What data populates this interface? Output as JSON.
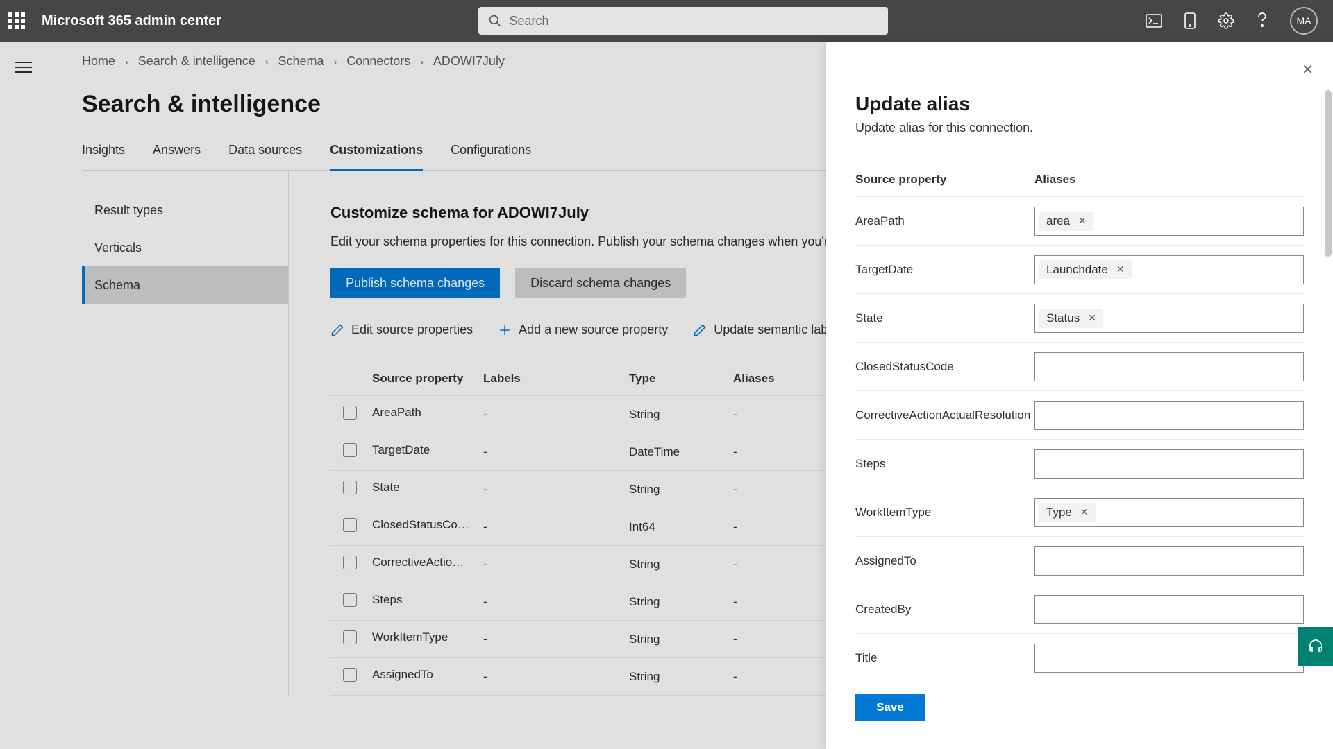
{
  "header": {
    "app_title": "Microsoft 365 admin center",
    "search_placeholder": "Search",
    "avatar_initials": "MA"
  },
  "breadcrumb": [
    "Home",
    "Search & intelligence",
    "Schema",
    "Connectors",
    "ADOWI7July"
  ],
  "page_title": "Search & intelligence",
  "tabs": [
    "Insights",
    "Answers",
    "Data sources",
    "Customizations",
    "Configurations"
  ],
  "active_tab": "Customizations",
  "sidenav": {
    "items": [
      "Result types",
      "Verticals",
      "Schema"
    ],
    "active": "Schema"
  },
  "section": {
    "title": "Customize schema for ADOWI7July",
    "desc": "Edit your schema properties for this connection. Publish your schema changes when you're done.",
    "publish_label": "Publish schema changes",
    "discard_label": "Discard schema changes"
  },
  "commands": {
    "edit": "Edit source properties",
    "add": "Add a new source property",
    "update": "Update semantic labels"
  },
  "table": {
    "headers": {
      "source": "Source property",
      "labels": "Labels",
      "type": "Type",
      "aliases": "Aliases"
    },
    "rows": [
      {
        "source": "AreaPath",
        "labels": "-",
        "type": "String",
        "aliases": "-"
      },
      {
        "source": "TargetDate",
        "labels": "-",
        "type": "DateTime",
        "aliases": "-"
      },
      {
        "source": "State",
        "labels": "-",
        "type": "String",
        "aliases": "-"
      },
      {
        "source": "ClosedStatusCode",
        "labels": "-",
        "type": "Int64",
        "aliases": "-"
      },
      {
        "source": "CorrectiveActio…",
        "labels": "-",
        "type": "String",
        "aliases": "-"
      },
      {
        "source": "Steps",
        "labels": "-",
        "type": "String",
        "aliases": "-"
      },
      {
        "source": "WorkItemType",
        "labels": "-",
        "type": "String",
        "aliases": "-"
      },
      {
        "source": "AssignedTo",
        "labels": "-",
        "type": "String",
        "aliases": "-"
      }
    ]
  },
  "panel": {
    "title": "Update alias",
    "desc": "Update alias for this connection.",
    "head_source": "Source property",
    "head_aliases": "Aliases",
    "rows": [
      {
        "source": "AreaPath",
        "chips": [
          "area"
        ]
      },
      {
        "source": "TargetDate",
        "chips": [
          "Launchdate"
        ]
      },
      {
        "source": "State",
        "chips": [
          "Status"
        ]
      },
      {
        "source": "ClosedStatusCode",
        "chips": []
      },
      {
        "source": "CorrectiveActionActualResolution",
        "chips": []
      },
      {
        "source": "Steps",
        "chips": []
      },
      {
        "source": "WorkItemType",
        "chips": [
          "Type"
        ]
      },
      {
        "source": "AssignedTo",
        "chips": []
      },
      {
        "source": "CreatedBy",
        "chips": []
      },
      {
        "source": "Title",
        "chips": []
      }
    ],
    "save_label": "Save"
  }
}
